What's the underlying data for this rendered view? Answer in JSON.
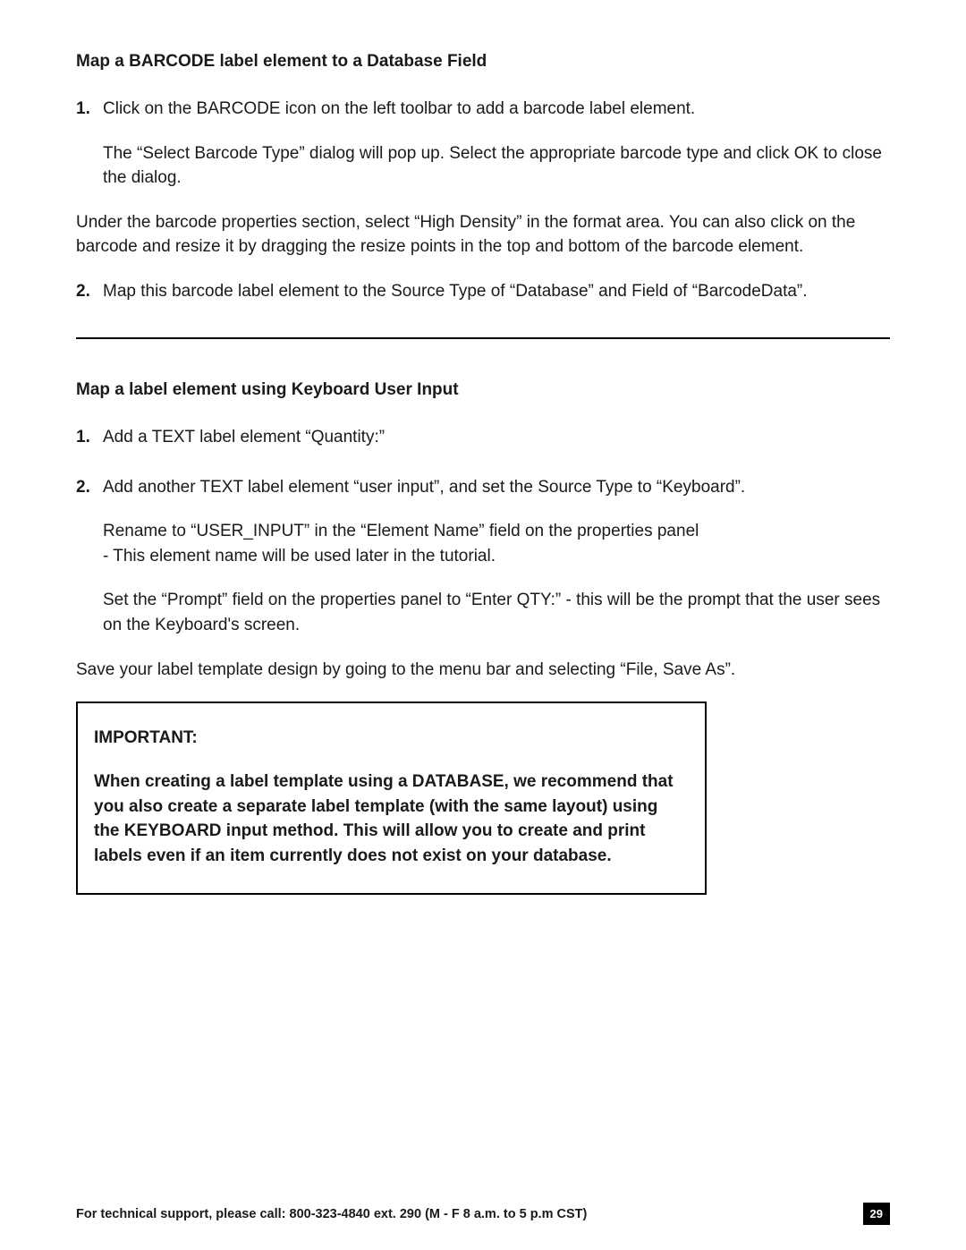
{
  "section1": {
    "heading": "Map a BARCODE label element to a Database Field",
    "item1_num": "1.",
    "item1_text": "Click on the BARCODE icon on the left toolbar to add a barcode label element.",
    "item1_sub": "The “Select Barcode Type” dialog will pop up.  Select the appropriate barcode type and click OK to close the dialog.",
    "para_under": "Under the barcode properties section, select “High Density” in the format area.  You can also click on the barcode and resize it by dragging the resize points in the top and bottom of the barcode element.",
    "item2_num": "2.",
    "item2_text": "Map this barcode label element to the Source Type of “Database” and Field of “BarcodeData”."
  },
  "section2": {
    "heading": "Map a label element using Keyboard User Input",
    "item1_num": "1.",
    "item1_text": "Add a TEXT label element “Quantity:”",
    "item2_num": "2.",
    "item2_text": "Add another TEXT label element “user input”, and set the Source Type to “Keyboard”.",
    "item2_sub1": "Rename to “USER_INPUT” in the “Element Name” field on the properties panel\n- This element name will be used later in the tutorial.",
    "item2_sub2": "Set the “Prompt” field on the properties panel to “Enter QTY:” - this will be the prompt that the user sees on the Keyboard's screen.",
    "save_para": "Save your label template design by going to the menu bar and selecting “File, Save As”."
  },
  "important": {
    "heading": "IMPORTANT:",
    "body": "When creating a label template using a DATABASE, we recommend that you also create a separate label template (with the same layout) using the KEYBOARD input method.  This will allow you to create and print labels even if an item currently does not exist on your database."
  },
  "footer": {
    "support_text": "For technical support, please call: 800-323-4840 ext. 290 (M - F  8 a.m. to 5 p.m CST)",
    "page_number": "29"
  }
}
